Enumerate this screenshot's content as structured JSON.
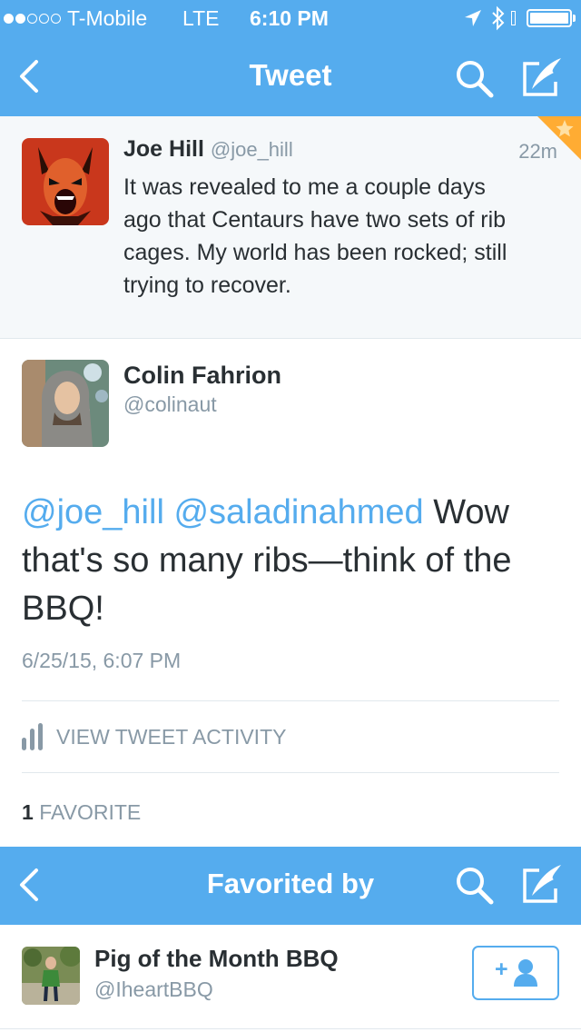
{
  "status_bar": {
    "carrier": "T-Mobile",
    "network": "LTE",
    "time": "6:10 PM",
    "signal_bars_filled": 2,
    "signal_bars_total": 5,
    "battery_level": 1.0,
    "icons": [
      "location-arrow-icon",
      "bluetooth-icon",
      "battery-icon"
    ]
  },
  "nav": {
    "title": "Tweet",
    "icons": [
      "back-chevron-icon",
      "search-icon",
      "compose-icon"
    ]
  },
  "parent_tweet": {
    "name": "Joe Hill",
    "handle": "@joe_hill",
    "time": "22m",
    "text": "It was revealed to me a couple days ago that Centaurs have two sets of rib cages. My world has been rocked; still trying to recover.",
    "text_lines": [
      "It was revealed to me a couple days",
      "ago that Centaurs have two sets of rib",
      "cages. My world has been rocked; still",
      "trying to recover."
    ],
    "favorited": true
  },
  "main_tweet": {
    "name": "Colin Fahrion",
    "handle": "@colinaut",
    "mention1": "@joe_hill",
    "mention2": "@saladinahmed",
    "text_part1": "Wow",
    "text_line2": "that's so many ribs—think of the",
    "text_line3": "BBQ!",
    "timestamp": "6/25/15, 6:07 PM",
    "activity_label": "VIEW TWEET ACTIVITY",
    "favorite_count": "1",
    "favorite_label": "FAVORITE"
  },
  "favorited_by": {
    "title": "Favorited by",
    "users": [
      {
        "name": "Pig of the Month BBQ",
        "handle": "@IheartBBQ",
        "follow_label": "+"
      }
    ]
  },
  "colors": {
    "twitter_blue": "#55acee",
    "text_dark": "#292f33",
    "text_gray": "#8899a6",
    "favorite_orange": "#ffac33"
  }
}
